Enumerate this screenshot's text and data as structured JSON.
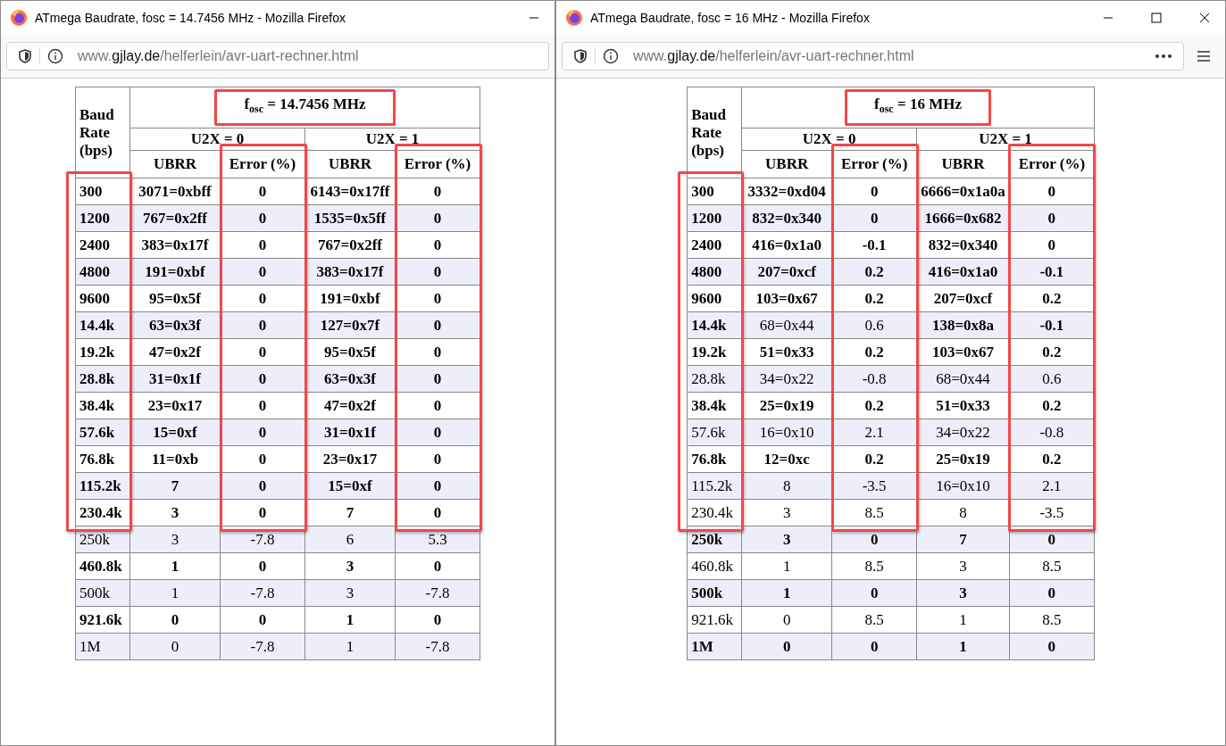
{
  "windows": [
    {
      "title": "ATmega Baudrate, fosc = 14.7456 MHz - Mozilla Firefox",
      "controls": [
        {
          "kind": "minimize"
        }
      ],
      "toolbar_menus": false,
      "url": {
        "prefix": "www.",
        "host": "gjlay.de",
        "path": "/helferlein/avr-uart-rechner.html"
      },
      "table": {
        "corner": "Baud Rate (bps)",
        "frequency": "f$_{osc}$ = 14.7456 MHz",
        "frequency_marked": true,
        "modes": [
          "U2X = 0",
          "U2X = 1"
        ],
        "columns": [
          "UBRR",
          "Error (%)",
          "UBRR",
          "Error (%)"
        ],
        "rows": [
          {
            "baud": "300",
            "bold": true,
            "marked": true,
            "cells": [
              {
                "ubrr": "3071=0xbff",
                "error": "0",
                "bold": true
              },
              {
                "ubrr": "6143=0x17ff",
                "error": "0",
                "bold": true
              }
            ]
          },
          {
            "baud": "1200",
            "bold": true,
            "marked": true,
            "cells": [
              {
                "ubrr": "767=0x2ff",
                "error": "0",
                "bold": true
              },
              {
                "ubrr": "1535=0x5ff",
                "error": "0",
                "bold": true
              }
            ]
          },
          {
            "baud": "2400",
            "bold": true,
            "marked": true,
            "cells": [
              {
                "ubrr": "383=0x17f",
                "error": "0",
                "bold": true
              },
              {
                "ubrr": "767=0x2ff",
                "error": "0",
                "bold": true
              }
            ]
          },
          {
            "baud": "4800",
            "bold": true,
            "marked": true,
            "cells": [
              {
                "ubrr": "191=0xbf",
                "error": "0",
                "bold": true
              },
              {
                "ubrr": "383=0x17f",
                "error": "0",
                "bold": true
              }
            ]
          },
          {
            "baud": "9600",
            "bold": true,
            "marked": true,
            "cells": [
              {
                "ubrr": "95=0x5f",
                "error": "0",
                "bold": true
              },
              {
                "ubrr": "191=0xbf",
                "error": "0",
                "bold": true
              }
            ]
          },
          {
            "baud": "14.4k",
            "bold": true,
            "marked": true,
            "cells": [
              {
                "ubrr": "63=0x3f",
                "error": "0",
                "bold": true
              },
              {
                "ubrr": "127=0x7f",
                "error": "0",
                "bold": true
              }
            ]
          },
          {
            "baud": "19.2k",
            "bold": true,
            "marked": true,
            "cells": [
              {
                "ubrr": "47=0x2f",
                "error": "0",
                "bold": true
              },
              {
                "ubrr": "95=0x5f",
                "error": "0",
                "bold": true
              }
            ]
          },
          {
            "baud": "28.8k",
            "bold": true,
            "marked": true,
            "cells": [
              {
                "ubrr": "31=0x1f",
                "error": "0",
                "bold": true
              },
              {
                "ubrr": "63=0x3f",
                "error": "0",
                "bold": true
              }
            ]
          },
          {
            "baud": "38.4k",
            "bold": true,
            "marked": true,
            "cells": [
              {
                "ubrr": "23=0x17",
                "error": "0",
                "bold": true
              },
              {
                "ubrr": "47=0x2f",
                "error": "0",
                "bold": true
              }
            ]
          },
          {
            "baud": "57.6k",
            "bold": true,
            "marked": true,
            "cells": [
              {
                "ubrr": "15=0xf",
                "error": "0",
                "bold": true
              },
              {
                "ubrr": "31=0x1f",
                "error": "0",
                "bold": true
              }
            ]
          },
          {
            "baud": "76.8k",
            "bold": true,
            "marked": true,
            "cells": [
              {
                "ubrr": "11=0xb",
                "error": "0",
                "bold": true
              },
              {
                "ubrr": "23=0x17",
                "error": "0",
                "bold": true
              }
            ]
          },
          {
            "baud": "115.2k",
            "bold": true,
            "marked": true,
            "cells": [
              {
                "ubrr": "7",
                "error": "0",
                "bold": true
              },
              {
                "ubrr": "15=0xf",
                "error": "0",
                "bold": true
              }
            ]
          },
          {
            "baud": "230.4k",
            "bold": true,
            "marked": true,
            "cells": [
              {
                "ubrr": "3",
                "error": "0",
                "bold": true
              },
              {
                "ubrr": "7",
                "error": "0",
                "bold": true
              }
            ]
          },
          {
            "baud": "250k",
            "bold": false,
            "marked": false,
            "cells": [
              {
                "ubrr": "3",
                "error": "-7.8",
                "bold": false
              },
              {
                "ubrr": "6",
                "error": "5.3",
                "bold": false
              }
            ]
          },
          {
            "baud": "460.8k",
            "bold": true,
            "marked": false,
            "cells": [
              {
                "ubrr": "1",
                "error": "0",
                "bold": true
              },
              {
                "ubrr": "3",
                "error": "0",
                "bold": true
              }
            ]
          },
          {
            "baud": "500k",
            "bold": false,
            "marked": false,
            "cells": [
              {
                "ubrr": "1",
                "error": "-7.8",
                "bold": false
              },
              {
                "ubrr": "3",
                "error": "-7.8",
                "bold": false
              }
            ]
          },
          {
            "baud": "921.6k",
            "bold": true,
            "marked": false,
            "cells": [
              {
                "ubrr": "0",
                "error": "0",
                "bold": true
              },
              {
                "ubrr": "1",
                "error": "0",
                "bold": true
              }
            ]
          },
          {
            "baud": "1M",
            "bold": false,
            "marked": false,
            "cells": [
              {
                "ubrr": "0",
                "error": "-7.8",
                "bold": false
              },
              {
                "ubrr": "1",
                "error": "-7.8",
                "bold": false
              }
            ]
          }
        ]
      }
    },
    {
      "title": "ATmega Baudrate, fosc = 16 MHz - Mozilla Firefox",
      "controls": [
        {
          "kind": "minimize"
        },
        {
          "kind": "maximize"
        },
        {
          "kind": "close"
        }
      ],
      "toolbar_menus": true,
      "url": {
        "prefix": "www.",
        "host": "gjlay.de",
        "path": "/helferlein/avr-uart-rechner.html"
      },
      "table": {
        "corner": "Baud Rate (bps)",
        "frequency": "f$_{osc}$ = 16 MHz",
        "frequency_marked": true,
        "modes": [
          "U2X = 0",
          "U2X = 1"
        ],
        "columns": [
          "UBRR",
          "Error (%)",
          "UBRR",
          "Error (%)"
        ],
        "rows": [
          {
            "baud": "300",
            "bold": true,
            "marked": true,
            "cells": [
              {
                "ubrr": "3332=0xd04",
                "error": "0",
                "bold": true
              },
              {
                "ubrr": "6666=0x1a0a",
                "error": "0",
                "bold": true
              }
            ]
          },
          {
            "baud": "1200",
            "bold": true,
            "marked": true,
            "cells": [
              {
                "ubrr": "832=0x340",
                "error": "0",
                "bold": true
              },
              {
                "ubrr": "1666=0x682",
                "error": "0",
                "bold": true
              }
            ]
          },
          {
            "baud": "2400",
            "bold": true,
            "marked": true,
            "cells": [
              {
                "ubrr": "416=0x1a0",
                "error": "-0.1",
                "bold": true
              },
              {
                "ubrr": "832=0x340",
                "error": "0",
                "bold": true
              }
            ]
          },
          {
            "baud": "4800",
            "bold": true,
            "marked": true,
            "cells": [
              {
                "ubrr": "207=0xcf",
                "error": "0.2",
                "bold": true
              },
              {
                "ubrr": "416=0x1a0",
                "error": "-0.1",
                "bold": true
              }
            ]
          },
          {
            "baud": "9600",
            "bold": true,
            "marked": true,
            "cells": [
              {
                "ubrr": "103=0x67",
                "error": "0.2",
                "bold": true
              },
              {
                "ubrr": "207=0xcf",
                "error": "0.2",
                "bold": true
              }
            ]
          },
          {
            "baud": "14.4k",
            "bold": true,
            "marked": true,
            "cells": [
              {
                "ubrr": "68=0x44",
                "error": "0.6",
                "bold": false
              },
              {
                "ubrr": "138=0x8a",
                "error": "-0.1",
                "bold": true
              }
            ]
          },
          {
            "baud": "19.2k",
            "bold": true,
            "marked": true,
            "cells": [
              {
                "ubrr": "51=0x33",
                "error": "0.2",
                "bold": true
              },
              {
                "ubrr": "103=0x67",
                "error": "0.2",
                "bold": true
              }
            ]
          },
          {
            "baud": "28.8k",
            "bold": false,
            "marked": true,
            "cells": [
              {
                "ubrr": "34=0x22",
                "error": "-0.8",
                "bold": false
              },
              {
                "ubrr": "68=0x44",
                "error": "0.6",
                "bold": false
              }
            ]
          },
          {
            "baud": "38.4k",
            "bold": true,
            "marked": true,
            "cells": [
              {
                "ubrr": "25=0x19",
                "error": "0.2",
                "bold": true
              },
              {
                "ubrr": "51=0x33",
                "error": "0.2",
                "bold": true
              }
            ]
          },
          {
            "baud": "57.6k",
            "bold": false,
            "marked": true,
            "cells": [
              {
                "ubrr": "16=0x10",
                "error": "2.1",
                "bold": false
              },
              {
                "ubrr": "34=0x22",
                "error": "-0.8",
                "bold": false
              }
            ]
          },
          {
            "baud": "76.8k",
            "bold": true,
            "marked": true,
            "cells": [
              {
                "ubrr": "12=0xc",
                "error": "0.2",
                "bold": true
              },
              {
                "ubrr": "25=0x19",
                "error": "0.2",
                "bold": true
              }
            ]
          },
          {
            "baud": "115.2k",
            "bold": false,
            "marked": true,
            "cells": [
              {
                "ubrr": "8",
                "error": "-3.5",
                "bold": false
              },
              {
                "ubrr": "16=0x10",
                "error": "2.1",
                "bold": false
              }
            ]
          },
          {
            "baud": "230.4k",
            "bold": false,
            "marked": true,
            "cells": [
              {
                "ubrr": "3",
                "error": "8.5",
                "bold": false
              },
              {
                "ubrr": "8",
                "error": "-3.5",
                "bold": false
              }
            ]
          },
          {
            "baud": "250k",
            "bold": true,
            "marked": false,
            "cells": [
              {
                "ubrr": "3",
                "error": "0",
                "bold": true
              },
              {
                "ubrr": "7",
                "error": "0",
                "bold": true
              }
            ]
          },
          {
            "baud": "460.8k",
            "bold": false,
            "marked": false,
            "cells": [
              {
                "ubrr": "1",
                "error": "8.5",
                "bold": false
              },
              {
                "ubrr": "3",
                "error": "8.5",
                "bold": false
              }
            ]
          },
          {
            "baud": "500k",
            "bold": true,
            "marked": false,
            "cells": [
              {
                "ubrr": "1",
                "error": "0",
                "bold": true
              },
              {
                "ubrr": "3",
                "error": "0",
                "bold": true
              }
            ]
          },
          {
            "baud": "921.6k",
            "bold": false,
            "marked": false,
            "cells": [
              {
                "ubrr": "0",
                "error": "8.5",
                "bold": false
              },
              {
                "ubrr": "1",
                "error": "8.5",
                "bold": false
              }
            ]
          },
          {
            "baud": "1M",
            "bold": true,
            "marked": false,
            "cells": [
              {
                "ubrr": "0",
                "error": "0",
                "bold": true
              },
              {
                "ubrr": "1",
                "error": "0",
                "bold": true
              }
            ]
          }
        ]
      }
    }
  ]
}
